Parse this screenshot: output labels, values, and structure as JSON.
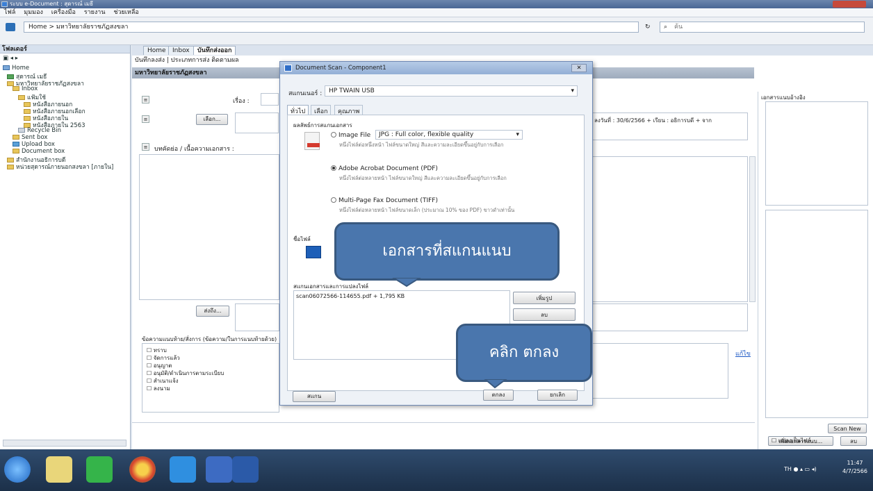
{
  "window": {
    "title": "ระบบ e-Document : สุดารณ์ เมธี"
  },
  "menu": [
    "ไฟล์",
    "มุมมอง",
    "เครื่องมือ",
    "รายงาน",
    "ช่วยเหลือ"
  ],
  "address": {
    "path": "Home > มหาวิทยาลัยราชภัฏสงขลา",
    "search_placeholder": "ค้น"
  },
  "tree": {
    "header": "โฟลเดอร์",
    "items": [
      "Home",
      "สุดารณ์ เมธี",
      "มหาวิทยาลัยราชภัฏสงขลา",
      "Inbox",
      "แฟ้มใช้",
      "หนังสือภายนอก",
      "หนังสือภายนอกเลือก",
      "หนังสือภายใน",
      "หนังสือภายใน 2563",
      "Recycle Bin",
      "Sent box",
      "Upload box",
      "Document box",
      "สำนักงานอธิการบดี",
      "หน่วยสุดารณ์ภายนอกสงขลา [ภายใน]"
    ]
  },
  "tabs": [
    "Home",
    "Inbox",
    "บันทึกส่งออก"
  ],
  "toolbar": {
    "items": "บันทึกลงส่ง | ประเภทการส่ง  ติดตามผล"
  },
  "section": {
    "title": "มหาวิทยาลัยราชภัฏสงขลา"
  },
  "form": {
    "subject_label": "เรื่อง :",
    "select_button": "เลือก...",
    "summary_label": "บทคัดย่อ / เนื้อความเอกสาร :",
    "send_button": "ส่งถึง...",
    "right_info": "ลงวันที่ :  30/6/2566 + เรียน : อธิการบดี + จาก",
    "comment_label": "ข้อความแนบท้าย/สั่งการ (ข้อความ/ในการแนบท้ายด้วย)",
    "comment_options": [
      "ทราบ",
      "จัดการแล้ว",
      "อนุญาต",
      "อนุมัติ/ดำเนินการตามระเบียบ",
      "สำเนาแจ้ง",
      "ลงนาม"
    ],
    "edit_link": "แก้ไข"
  },
  "right_pane": {
    "header": "เอกสารแนบอ้างอิง",
    "scan_button": "Scan New",
    "attach_button": "เพิ่มเอกสารแนบ...",
    "remove_button": "ลบ",
    "checkbox_label": "แปลงเป็นไฟล์"
  },
  "dialog": {
    "title": "Document Scan - Component1",
    "scanner_label": "สแกนเนอร์ :",
    "scanner_value": "HP TWAIN USB",
    "tabs": [
      "ทั่วไป",
      "เลือก",
      "คุณภาพ"
    ],
    "group_label": "ผลลัพธ์การสแกนเอกสาร",
    "opt1_title": "Image File",
    "opt1_format": "JPG : Full color, flexible quality",
    "opt1_desc": "หนึ่งไฟล์ต่อหนึ่งหน้า ไฟล์ขนาดใหญ่ สีและความละเอียดขึ้นอยู่กับการเลือก",
    "opt2_title": "Adobe Acrobat Document (PDF)",
    "opt2_desc": "หนึ่งไฟล์ต่อหลายหน้า ไฟล์ขนาดใหญ่ สีและความละเอียดขึ้นอยู่กับการเลือก",
    "opt3_title": "Multi-Page Fax Document (TIFF)",
    "opt3_desc": "หนึ่งไฟล์ต่อหลายหน้า ไฟล์ขนาดเล็ก (ประมาณ 10% ของ PDF) ขาวดำเท่านั้น",
    "file_label": "ชื่อไฟล์",
    "scanned_label": "สแกนเอกสารและการแปลงไฟล์",
    "file_item": "scan06072566-114655.pdf + 1,795 KB",
    "btn_info": "เพิ่มรูป",
    "btn_del": "ลบ",
    "btn_scan": "สแกน",
    "btn_ok": "ตกลง",
    "btn_cancel": "ยกเลิก"
  },
  "callouts": {
    "scanned": "เอกสารที่สแกนแนบ",
    "click_ok": "คลิก ตกลง"
  },
  "taskbar": {
    "time": "11:47",
    "date": "4/7/2566"
  }
}
